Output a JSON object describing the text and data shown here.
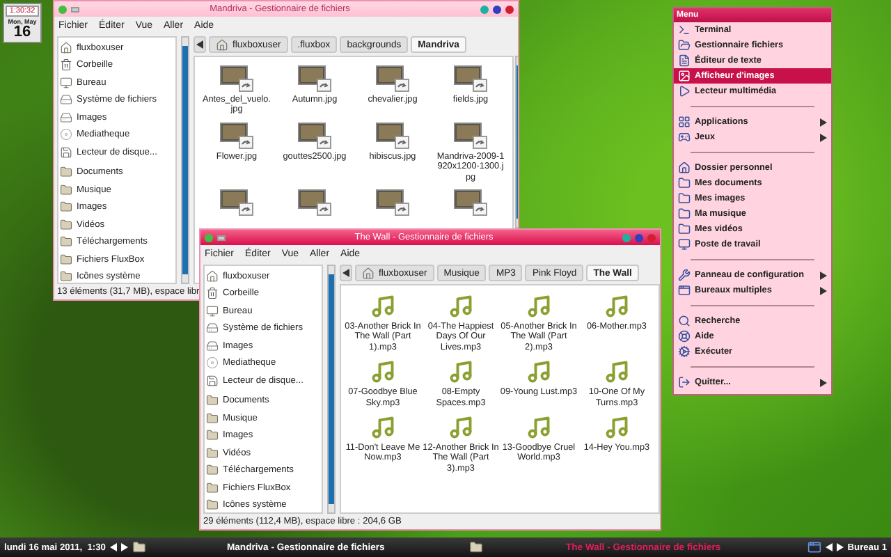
{
  "clock": {
    "time": "1:30:32",
    "day": "Mon, May",
    "date": "16"
  },
  "windows": [
    {
      "title": "Mandriva - Gestionnaire de fichiers",
      "active": false,
      "menu": [
        "Fichier",
        "Éditer",
        "Vue",
        "Aller",
        "Aide"
      ],
      "places": [
        "fluxboxuser",
        "Corbeille",
        "Bureau",
        "Système de fichiers",
        "Images",
        "Mediatheque",
        "Lecteur de disque..."
      ],
      "bookmarks": [
        "Documents",
        "Musique",
        "Images",
        "Vidéos",
        "Téléchargements",
        "Fichiers FluxBox",
        "Icônes système"
      ],
      "path": [
        {
          "label": "fluxboxuser",
          "selected": false
        },
        {
          "label": ".fluxbox",
          "selected": false
        },
        {
          "label": "backgrounds",
          "selected": false
        },
        {
          "label": "Mandriva",
          "selected": true
        }
      ],
      "files": [
        {
          "name": "Antes_del_vuelo.jpg",
          "kind": "image"
        },
        {
          "name": "Autumn.jpg",
          "kind": "image"
        },
        {
          "name": "chevalier.jpg",
          "kind": "image"
        },
        {
          "name": "fields.jpg",
          "kind": "image"
        },
        {
          "name": "Flower.jpg",
          "kind": "image"
        },
        {
          "name": "gouttes2500.jpg",
          "kind": "image"
        },
        {
          "name": "hibiscus.jpg",
          "kind": "image"
        },
        {
          "name": "Mandriva-2009-1920x1200-1300.jpg",
          "kind": "image"
        },
        {
          "kind": "image"
        },
        {
          "kind": "image"
        },
        {
          "kind": "image"
        },
        {
          "kind": "image"
        }
      ],
      "status": "13 éléments (31,7 MB), espace libr"
    },
    {
      "title": "The Wall - Gestionnaire de fichiers",
      "active": true,
      "menu": [
        "Fichier",
        "Éditer",
        "Vue",
        "Aller",
        "Aide"
      ],
      "places": [
        "fluxboxuser",
        "Corbeille",
        "Bureau",
        "Système de fichiers",
        "Images",
        "Mediatheque",
        "Lecteur de disque..."
      ],
      "bookmarks": [
        "Documents",
        "Musique",
        "Images",
        "Vidéos",
        "Téléchargements",
        "Fichiers FluxBox",
        "Icônes système"
      ],
      "path": [
        {
          "label": "fluxboxuser",
          "selected": false
        },
        {
          "label": "Musique",
          "selected": false
        },
        {
          "label": "MP3",
          "selected": false
        },
        {
          "label": "Pink Floyd",
          "selected": false
        },
        {
          "label": "The Wall",
          "selected": true
        }
      ],
      "files": [
        {
          "name": "03-Another Brick In The Wall (Part 1).mp3",
          "kind": "audio"
        },
        {
          "name": "04-The Happiest Days Of Our Lives.mp3",
          "kind": "audio"
        },
        {
          "name": "05-Another Brick In The Wall (Part 2).mp3",
          "kind": "audio"
        },
        {
          "name": "06-Mother.mp3",
          "kind": "audio"
        },
        {
          "name": "07-Goodbye Blue Sky.mp3",
          "kind": "audio"
        },
        {
          "name": "08-Empty Spaces.mp3",
          "kind": "audio"
        },
        {
          "name": "09-Young Lust.mp3",
          "kind": "audio"
        },
        {
          "name": "10-One Of My Turns.mp3",
          "kind": "audio"
        },
        {
          "name": "11-Don't Leave Me Now.mp3",
          "kind": "audio"
        },
        {
          "name": "12-Another Brick In The Wall (Part 3).mp3",
          "kind": "audio"
        },
        {
          "name": "13-Goodbye Cruel World.mp3",
          "kind": "audio"
        },
        {
          "name": "14-Hey You.mp3",
          "kind": "audio"
        }
      ],
      "status": "29 éléments (112,4 MB), espace libre : 204,6 GB"
    }
  ],
  "menu": {
    "title": "Menu",
    "items": [
      {
        "kind": "item",
        "label": "Terminal",
        "selected": false,
        "submenu": false
      },
      {
        "kind": "item",
        "label": "Gestionnaire fichiers",
        "selected": false,
        "submenu": false
      },
      {
        "kind": "item",
        "label": "Éditeur de texte",
        "selected": false,
        "submenu": false
      },
      {
        "kind": "item",
        "label": "Afficheur d'images",
        "selected": true,
        "submenu": false
      },
      {
        "kind": "item",
        "label": "Lecteur multimédia",
        "selected": false,
        "submenu": false
      },
      {
        "kind": "separator"
      },
      {
        "kind": "item",
        "label": "Applications",
        "selected": false,
        "submenu": true
      },
      {
        "kind": "item",
        "label": "Jeux",
        "selected": false,
        "submenu": true
      },
      {
        "kind": "separator"
      },
      {
        "kind": "item",
        "label": "Dossier personnel",
        "selected": false,
        "submenu": false
      },
      {
        "kind": "item",
        "label": "Mes documents",
        "selected": false,
        "submenu": false
      },
      {
        "kind": "item",
        "label": "Mes images",
        "selected": false,
        "submenu": false
      },
      {
        "kind": "item",
        "label": "Ma musique",
        "selected": false,
        "submenu": false
      },
      {
        "kind": "item",
        "label": "Mes vidéos",
        "selected": false,
        "submenu": false
      },
      {
        "kind": "item",
        "label": "Poste de travail",
        "selected": false,
        "submenu": false
      },
      {
        "kind": "separator"
      },
      {
        "kind": "item",
        "label": "Panneau de configuration",
        "selected": false,
        "submenu": true
      },
      {
        "kind": "item",
        "label": "Bureaux multiples",
        "selected": false,
        "submenu": true
      },
      {
        "kind": "separator"
      },
      {
        "kind": "item",
        "label": "Recherche",
        "selected": false,
        "submenu": false
      },
      {
        "kind": "item",
        "label": "Aide",
        "selected": false,
        "submenu": false
      },
      {
        "kind": "item",
        "label": "Exécuter",
        "selected": false,
        "submenu": false
      },
      {
        "kind": "separator"
      },
      {
        "kind": "item",
        "label": "Quitter...",
        "selected": false,
        "submenu": true
      }
    ]
  },
  "taskbar": {
    "datetime": "lundi 16 mai 2011,  1:30",
    "tasks": [
      {
        "title": "Mandriva - Gestionnaire de fichiers",
        "active": false
      },
      {
        "title": "The Wall - Gestionnaire de fichiers",
        "active": true
      }
    ],
    "workspace": "Bureau 1"
  }
}
